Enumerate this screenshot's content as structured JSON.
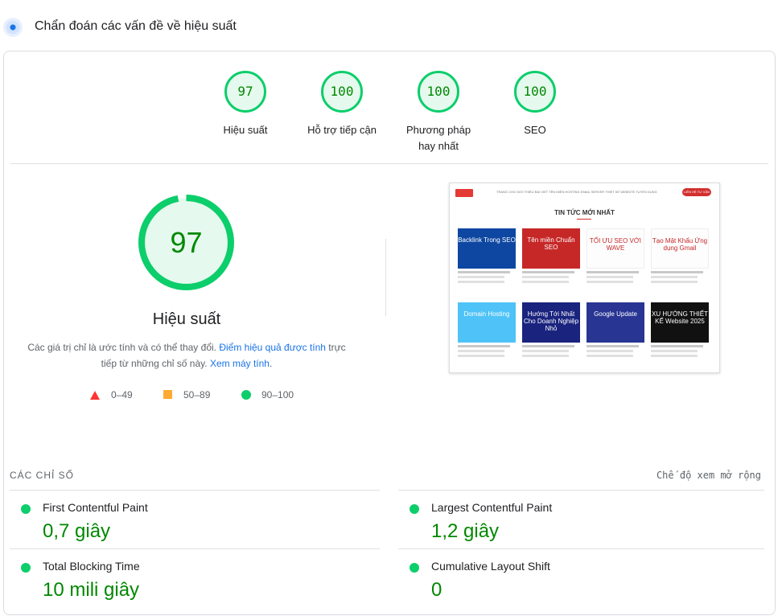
{
  "header": {
    "title": "Chẩn đoán các vấn đề về hiệu suất",
    "icon": "diagnose-icon"
  },
  "categories": [
    {
      "score": "97",
      "label": "Hiệu suất"
    },
    {
      "score": "100",
      "label": "Hỗ trợ tiếp cận"
    },
    {
      "score": "100",
      "label": "Phương pháp hay nhất"
    },
    {
      "score": "100",
      "label": "SEO"
    }
  ],
  "performance": {
    "score": "97",
    "score_fraction": 0.97,
    "title": "Hiệu suất",
    "note_text": "Các giá trị chỉ là ước tính và có thể thay đổi. ",
    "note_link1": "Điểm hiệu quả được tính",
    "note_mid": " trực tiếp từ những chỉ số này. ",
    "note_link2": "Xem máy tính",
    "note_end": "."
  },
  "legend": {
    "bad": "0–49",
    "average": "50–89",
    "good": "90–100",
    "colors": {
      "bad": "#ff3333",
      "average": "#ffaa33",
      "good": "#0cce6b"
    }
  },
  "screenshot": {
    "nav": "TRANG CHỦ   GIỚI THIỆU   BÀI VIẾT   TÊN MIỀN   HOSTING   EMAIL SERVER   THIẾT KẾ WEBSITE   TUYỂN DỤNG",
    "nav_button": "LIÊN HỆ TƯ VẤN",
    "section_title": "TIN TỨC MỚI NHẤT",
    "cards": [
      {
        "thumb": "Backlink Trong SEO",
        "color": "#0d47a1"
      },
      {
        "thumb": "Tên miền Chuẩn SEO",
        "color": "#c62828"
      },
      {
        "thumb": "TỐI ƯU SEO VỚI WAVE",
        "color": "#fdfdfd"
      },
      {
        "thumb": "Tạo Mật Khẩu Ứng dụng Gmail",
        "color": "#fdfdfd"
      },
      {
        "thumb": "Domain Hosting",
        "color": "#4fc3f7"
      },
      {
        "thumb": "Hướng Tới Nhất Cho Doanh Nghiệp Nhỏ",
        "color": "#1a237e"
      },
      {
        "thumb": "Google Update",
        "color": "#283593"
      },
      {
        "thumb": "XU HƯỚNG THIẾT KẾ Website 2025",
        "color": "#111111"
      }
    ]
  },
  "metrics_section": {
    "title": "CÁC CHỈ SỐ",
    "expand_label": "Chế độ xem mở rộng"
  },
  "metrics": [
    {
      "name": "First Contentful Paint",
      "value": "0,7 giây"
    },
    {
      "name": "Largest Contentful Paint",
      "value": "1,2 giây"
    },
    {
      "name": "Total Blocking Time",
      "value": "10 mili giây"
    },
    {
      "name": "Cumulative Layout Shift",
      "value": "0"
    }
  ]
}
